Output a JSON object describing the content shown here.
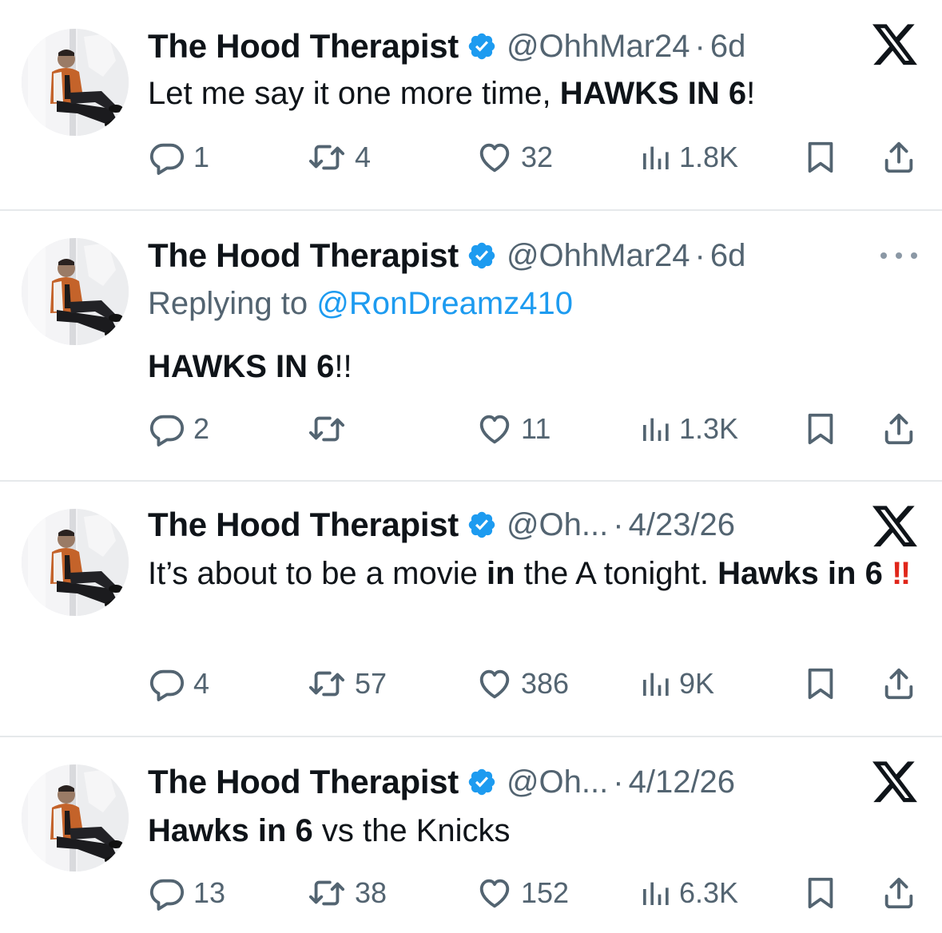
{
  "tweets": [
    {
      "name": "The Hood Therapist",
      "handle": "@OhhMar24",
      "time": "6d",
      "menu": "x-logo",
      "replying_prefix": "",
      "replying_mention": "",
      "text_parts": [
        {
          "t": "Let me say it one more time, ",
          "bold": false
        },
        {
          "t": "HAWKS IN 6",
          "bold": true
        },
        {
          "t": "!",
          "bold": false
        }
      ],
      "replies": "1",
      "reposts": "4",
      "likes": "32",
      "views": "1.8K"
    },
    {
      "name": "The Hood Therapist",
      "handle": "@OhhMar24",
      "time": "6d",
      "menu": "more-menu",
      "replying_prefix": "Replying to ",
      "replying_mention": "@RonDreamz410",
      "text_parts": [
        {
          "t": "HAWKS IN 6",
          "bold": true
        },
        {
          "t": "!!",
          "bold": false
        }
      ],
      "replies": "2",
      "reposts": "",
      "likes": "11",
      "views": "1.3K"
    },
    {
      "name": "The Hood Therapist",
      "handle": "@Oh...",
      "time": "4/23/26",
      "menu": "x-logo",
      "replying_prefix": "",
      "replying_mention": "",
      "text_parts": [
        {
          "t": "It’s about to be a movie ",
          "bold": false
        },
        {
          "t": "in",
          "bold": true
        },
        {
          "t": " the A tonight. ",
          "bold": false
        },
        {
          "t": "Hawks in 6",
          "bold": true
        },
        {
          "t": " ",
          "bold": false
        },
        {
          "t": "‼",
          "emoji": true
        }
      ],
      "replies": "4",
      "reposts": "57",
      "likes": "386",
      "views": "9K"
    },
    {
      "name": "The Hood Therapist",
      "handle": "@Oh...",
      "time": "4/12/26",
      "menu": "x-logo",
      "replying_prefix": "",
      "replying_mention": "",
      "text_parts": [
        {
          "t": "Hawks in 6",
          "bold": true
        },
        {
          "t": " vs the Knicks",
          "bold": false
        }
      ],
      "replies": "13",
      "reposts": "38",
      "likes": "152",
      "views": "6.3K"
    }
  ],
  "colors": {
    "text": "#0f1419",
    "muted": "#536471",
    "link": "#1d9bf0",
    "verified": "#1d9bf0",
    "divider": "#e6e9eb",
    "emoji_red": "#e0261a"
  },
  "icons": {
    "reply": "reply-icon",
    "repost": "repost-icon",
    "like": "heart-icon",
    "views": "views-icon",
    "bookmark": "bookmark-icon",
    "share": "share-icon",
    "verified": "verified-badge-icon",
    "avatar": "avatar"
  }
}
